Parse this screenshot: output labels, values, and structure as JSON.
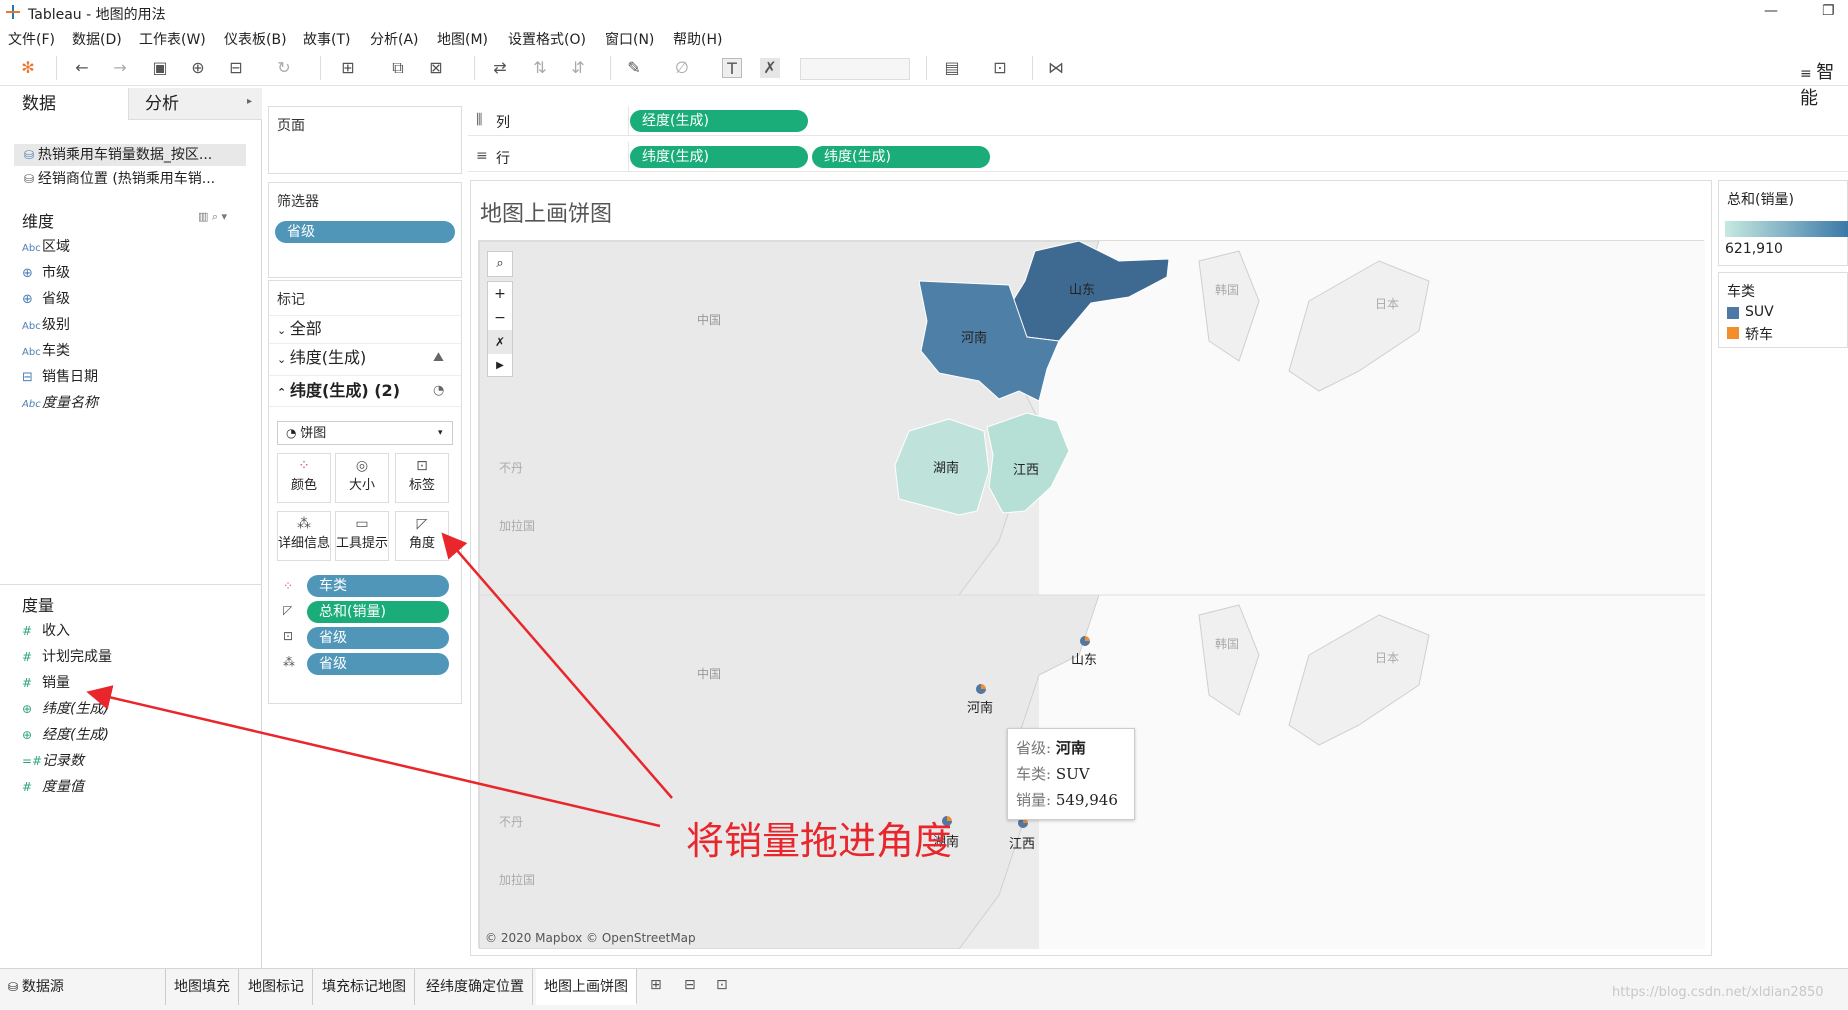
{
  "app": {
    "window_title": "Tableau - 地图的用法",
    "menu": [
      "文件(F)",
      "数据(D)",
      "工作表(W)",
      "仪表板(B)",
      "故事(T)",
      "分析(A)",
      "地图(M)",
      "设置格式(O)",
      "窗口(N)",
      "帮助(H)"
    ],
    "toolbar_right_label": "智能"
  },
  "data_pane": {
    "tabs": [
      "数据",
      "分析"
    ],
    "sources": [
      "热销乘用车销量数据_按区...",
      "经销商位置 (热销乘用车销..."
    ],
    "dimensions_header": "维度",
    "dimensions": [
      {
        "type": "Abc",
        "label": "区域"
      },
      {
        "type": "globe",
        "label": "市级"
      },
      {
        "type": "globe",
        "label": "省级"
      },
      {
        "type": "Abc",
        "label": "级别"
      },
      {
        "type": "Abc",
        "label": "车类"
      },
      {
        "type": "date",
        "label": "销售日期"
      },
      {
        "type": "Abc",
        "label": "度量名称"
      }
    ],
    "measures_header": "度量",
    "measures": [
      {
        "type": "#",
        "label": "收入"
      },
      {
        "type": "#",
        "label": "计划完成量"
      },
      {
        "type": "#",
        "label": "销量"
      },
      {
        "type": "globe",
        "label": "纬度(生成)"
      },
      {
        "type": "globe",
        "label": "经度(生成)"
      },
      {
        "type": "=#",
        "label": "记录数"
      },
      {
        "type": "#",
        "label": "度量值"
      }
    ]
  },
  "shelves": {
    "pages_label": "页面",
    "filters_label": "筛选器",
    "filter_pill": "省级",
    "columns_label": "列",
    "rows_label": "行",
    "column_pills": [
      "经度(生成)"
    ],
    "row_pills": [
      "纬度(生成)",
      "纬度(生成)"
    ]
  },
  "marks": {
    "header": "标记",
    "sections": [
      "全部",
      "纬度(生成)",
      "纬度(生成) (2)"
    ],
    "mark_type": "饼图",
    "buttons": [
      "颜色",
      "大小",
      "标签",
      "详细信息",
      "工具提示",
      "角度"
    ],
    "pills": [
      {
        "role": "color",
        "label": "车类",
        "color": "#4f96b9"
      },
      {
        "role": "angle",
        "label": "总和(销量)",
        "color": "#1aad7a"
      },
      {
        "role": "label",
        "label": "省级",
        "color": "#4f96b9"
      },
      {
        "role": "detail",
        "label": "省级",
        "color": "#4f96b9"
      }
    ]
  },
  "view": {
    "title": "地图上画饼图",
    "map_attribution": "© 2020 Mapbox © OpenStreetMap",
    "top_map": {
      "provinces": [
        {
          "name": "山东",
          "fill": "#3e6a92"
        },
        {
          "name": "河南",
          "fill": "#4e7fa6"
        },
        {
          "name": "湖南",
          "fill": "#bfe3da"
        },
        {
          "name": "江西",
          "fill": "#b6e0d6"
        }
      ],
      "base_labels": [
        "中国",
        "韩国",
        "日本",
        "不丹",
        "加拉国"
      ]
    },
    "bottom_map": {
      "pie_labels": [
        "山东",
        "河南",
        "湖南",
        "江西"
      ],
      "base_labels": [
        "中国",
        "韩国",
        "日本",
        "不丹",
        "加拉国"
      ]
    },
    "tooltip": [
      {
        "key": "省级:",
        "value": "河南"
      },
      {
        "key": "车类:",
        "value": "SUV"
      },
      {
        "key": "销量:",
        "value": "549,946"
      }
    ],
    "annotation": "将销量拖进角度"
  },
  "legend": {
    "color_title": "总和(销量)",
    "color_min": "621,910",
    "category_title": "车类",
    "categories": [
      {
        "label": "SUV",
        "color": "#4e79a7"
      },
      {
        "label": "轿车",
        "color": "#f28e2b"
      }
    ]
  },
  "bottom_tabs": {
    "datasource": "数据源",
    "sheets": [
      "地图填充",
      "地图标记",
      "填充标记地图",
      "经纬度确定位置",
      "地图上画饼图"
    ],
    "active": "地图上画饼图",
    "watermark": "https://blog.csdn.net/xldian2850"
  }
}
